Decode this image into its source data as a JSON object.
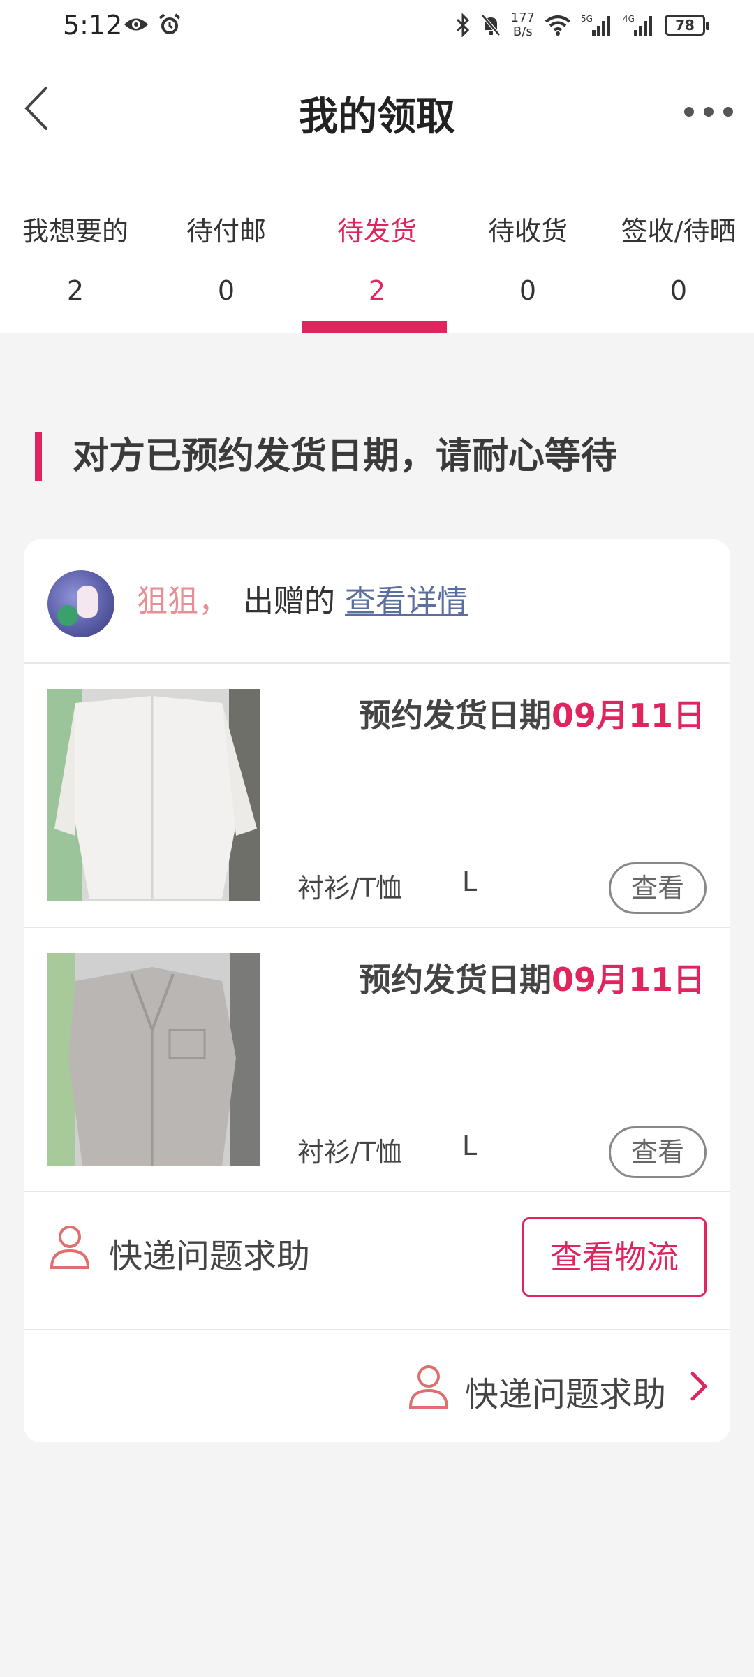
{
  "status_bar": {
    "time": "5:12",
    "net_speed_value": "177",
    "net_speed_unit": "B/s",
    "sig1": "5G",
    "sig2": "4G",
    "battery": "78"
  },
  "header": {
    "title": "我的领取",
    "back_icon": "chevron-left-icon",
    "more_icon": "more-dots-icon"
  },
  "tabs": [
    {
      "label": "我想要的",
      "count": "2",
      "active": false
    },
    {
      "label": "待付邮",
      "count": "0",
      "active": false
    },
    {
      "label": "待发货",
      "count": "2",
      "active": true
    },
    {
      "label": "待收货",
      "count": "0",
      "active": false
    },
    {
      "label": "签收/待晒",
      "count": "0",
      "active": false
    }
  ],
  "notice": "对方已预约发货日期，请耐心等待",
  "order": {
    "giver_name": "狙狙，",
    "gave_text": "出赠的",
    "detail_link": "查看详情",
    "items": [
      {
        "date_prefix": "预约发货日期",
        "date": "09月11日",
        "category": "衬衫/T恤",
        "size": "L",
        "view_label": "查看"
      },
      {
        "date_prefix": "预约发货日期",
        "date": "09月11日",
        "category": "衬衫/T恤",
        "size": "L",
        "view_label": "查看"
      }
    ],
    "help_label": "快递问题求助",
    "logistics_label": "查看物流",
    "footer_help_label": "快递问题求助"
  },
  "colors": {
    "accent": "#e0245e",
    "link": "#5a6fa0",
    "name": "#e88f96",
    "background": "#f4f4f4"
  }
}
